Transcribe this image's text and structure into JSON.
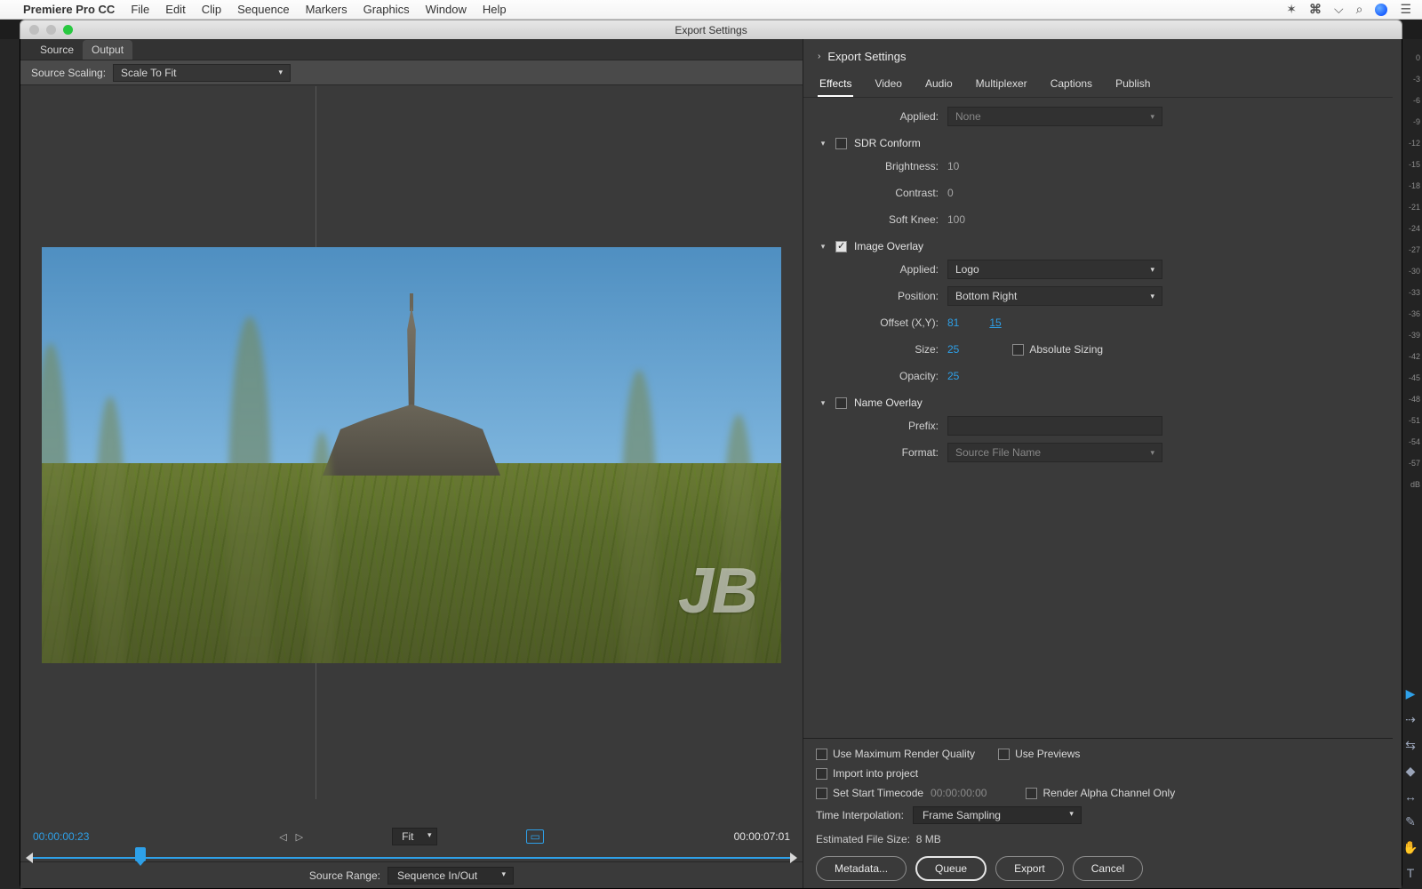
{
  "menubar": {
    "app": "Premiere Pro CC",
    "items": [
      "File",
      "Edit",
      "Clip",
      "Sequence",
      "Markers",
      "Graphics",
      "Window",
      "Help"
    ]
  },
  "window": {
    "title": "Export Settings"
  },
  "source": {
    "tabs": [
      "Source",
      "Output"
    ],
    "scaling_label": "Source Scaling:",
    "scaling_value": "Scale To Fit"
  },
  "preview": {
    "overlay_text": "JB",
    "tc_in": "00:00:00:23",
    "tc_out": "00:00:07:01",
    "fit_label": "Fit",
    "range_label": "Source Range:",
    "range_value": "Sequence In/Out"
  },
  "right": {
    "header": "Export Settings",
    "tabs": [
      "Effects",
      "Video",
      "Audio",
      "Multiplexer",
      "Captions",
      "Publish"
    ],
    "applied_lbl": "Applied:",
    "applied_none": "None",
    "sdr": {
      "title": "SDR Conform",
      "brightness_lbl": "Brightness:",
      "brightness_val": "10",
      "contrast_lbl": "Contrast:",
      "contrast_val": "0",
      "softknee_lbl": "Soft Knee:",
      "softknee_val": "100"
    },
    "imgov": {
      "title": "Image Overlay",
      "applied_lbl": "Applied:",
      "applied_val": "Logo",
      "position_lbl": "Position:",
      "position_val": "Bottom Right",
      "offset_lbl": "Offset (X,Y):",
      "offset_x": "81",
      "offset_y": "15",
      "size_lbl": "Size:",
      "size_val": "25",
      "abs_lbl": "Absolute Sizing",
      "opacity_lbl": "Opacity:",
      "opacity_val": "25"
    },
    "nameov": {
      "title": "Name Overlay",
      "prefix_lbl": "Prefix:",
      "format_lbl": "Format:",
      "format_val": "Source File Name"
    }
  },
  "bottom": {
    "maxq": "Use Maximum Render Quality",
    "previews": "Use Previews",
    "import": "Import into project",
    "starttc": "Set Start Timecode",
    "starttc_val": "00:00:00:00",
    "alpha": "Render Alpha Channel Only",
    "interp_lbl": "Time Interpolation:",
    "interp_val": "Frame Sampling",
    "est_lbl": "Estimated File Size:",
    "est_val": "8 MB",
    "metadata": "Metadata...",
    "queue": "Queue",
    "export": "Export",
    "cancel": "Cancel"
  },
  "dbmeter": [
    "0",
    "-3",
    "-6",
    "-9",
    "-12",
    "-15",
    "-18",
    "-21",
    "-24",
    "-27",
    "-30",
    "-33",
    "-36",
    "-39",
    "-42",
    "-45",
    "-48",
    "-51",
    "-54",
    "-57",
    "dB"
  ]
}
